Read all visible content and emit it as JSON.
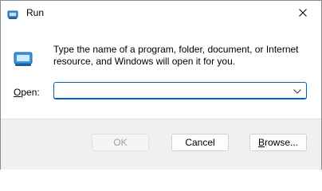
{
  "window": {
    "title": "Run",
    "title_icon": "run-icon",
    "close_icon": "close-icon"
  },
  "dialog": {
    "app_icon": "run-app-icon",
    "description": "Type the name of a program, folder, document, or Internet resource, and Windows will open it for you.",
    "open_label_mnemonic": "O",
    "open_label_rest": "pen:",
    "open_value": "",
    "dropdown_icon": "chevron-down-icon"
  },
  "buttons": {
    "ok": "OK",
    "cancel": "Cancel",
    "browse_mnemonic": "B",
    "browse_rest": "rowse..."
  },
  "colors": {
    "accent": "#0067c0",
    "footer_bg": "#f0f0f0",
    "disabled_text": "#a0a0a0"
  }
}
